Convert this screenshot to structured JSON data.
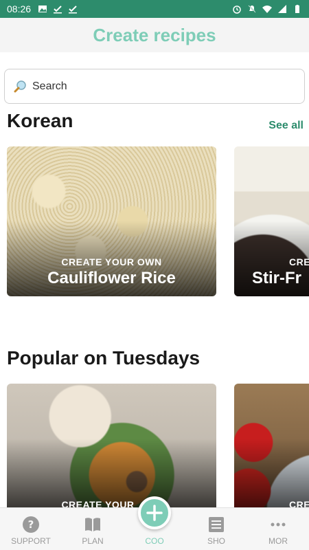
{
  "status_bar": {
    "time": "08:26",
    "left_icons": [
      "image-icon",
      "check-icon",
      "check-icon"
    ],
    "right_icons": [
      "alarm-icon",
      "mute-icon",
      "wifi-icon",
      "signal-icon",
      "battery-icon"
    ]
  },
  "header": {
    "title": "Create recipes"
  },
  "search": {
    "placeholder": "Search",
    "icon": "search-icon"
  },
  "sections": [
    {
      "title": "Korean",
      "see_all": "See all",
      "cards": [
        {
          "kicker": "CREATE YOUR OWN",
          "name": "Cauliflower Rice"
        },
        {
          "kicker": "CRE",
          "name": "Stir-Fr"
        }
      ]
    },
    {
      "title": "Popular on Tuesdays",
      "cards": [
        {
          "kicker": "CREATE YOUR"
        },
        {
          "kicker": "CRE"
        }
      ]
    }
  ],
  "bottom_nav": {
    "items": [
      {
        "label": "SUPPORT",
        "icon": "help-icon"
      },
      {
        "label": "PLAN",
        "icon": "book-icon"
      },
      {
        "label": "COO",
        "icon": "plus-icon",
        "active": true
      },
      {
        "label": "SHO",
        "icon": "list-icon"
      },
      {
        "label": "MOR",
        "icon": "more-icon"
      }
    ]
  },
  "colors": {
    "status_bar": "#2d8c6c",
    "accent": "#7ecdb7",
    "link": "#2d8c6c"
  }
}
